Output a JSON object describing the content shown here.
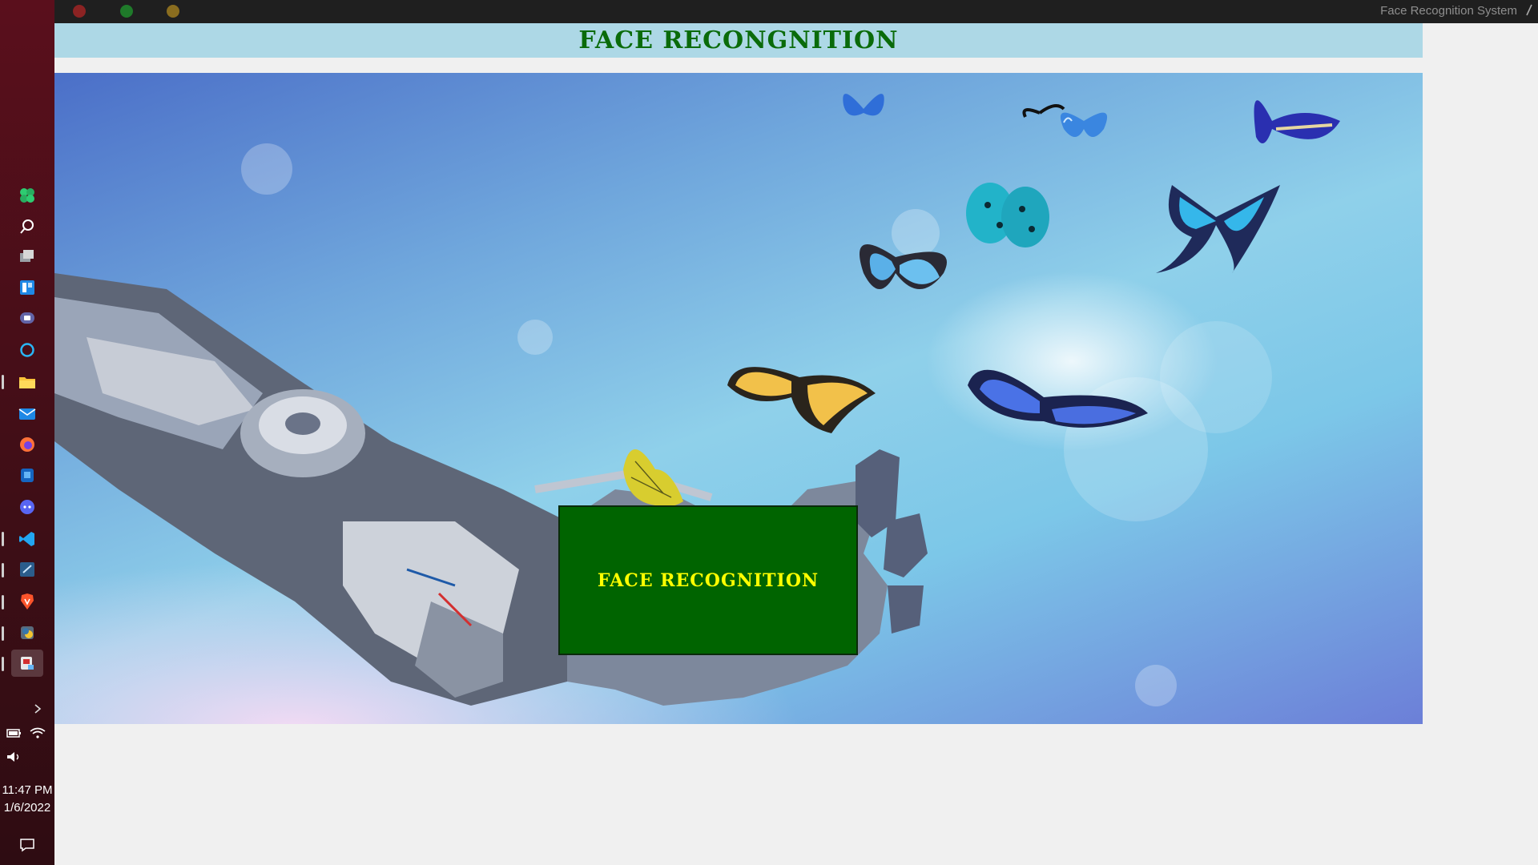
{
  "window": {
    "title": "Face Recognition System",
    "controls": [
      "close",
      "minimize",
      "maximize"
    ]
  },
  "app": {
    "header_title": "FACE RECONGNITION",
    "primary_button_label": "FACE RECOGNITION",
    "colors": {
      "header_bg": "#add8e6",
      "header_text": "#0a6b0a",
      "button_bg": "#006400",
      "button_text": "#ffff00"
    }
  },
  "hero_image": {
    "description_icons": [
      "robot-hand",
      "butterflies"
    ]
  },
  "taskbar": {
    "apps": [
      "widgets-icon",
      "search-icon",
      "task-view-icon",
      "widgets-board-icon",
      "teams-icon",
      "cortana-icon",
      "file-explorer-icon",
      "mail-icon",
      "firefox-icon",
      "app-store-icon",
      "discord-icon",
      "vscode-icon",
      "code-editor-icon",
      "brave-icon",
      "python-icon",
      "face-recognition-app-icon"
    ],
    "tray": {
      "clock_time": "11:47 PM",
      "clock_date": "1/6/2022"
    }
  }
}
